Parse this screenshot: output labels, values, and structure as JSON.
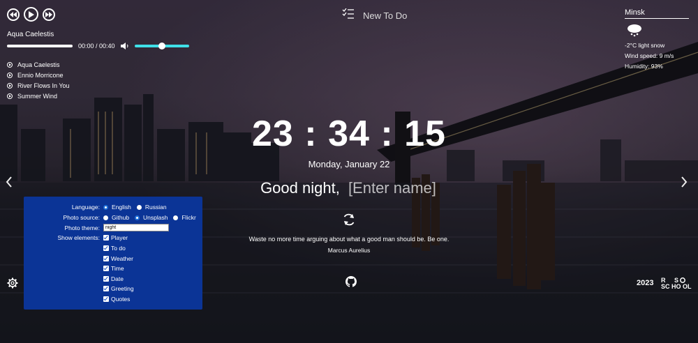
{
  "player": {
    "track_title": "Aqua Caelestis",
    "time": "00:00 / 00:40",
    "progress": 0,
    "volume": 0.5,
    "playlist": [
      "Aqua Caelestis",
      "Ennio Morricone",
      "River Flows In You",
      "Summer Wind"
    ]
  },
  "todo": {
    "label": "New To Do"
  },
  "weather": {
    "city": "Minsk",
    "temp_desc": "-2°C   light snow",
    "wind": "Wind speed: 9 m/s",
    "humidity": "Humidity: 93%"
  },
  "clock": {
    "time": "23 : 34 : 15",
    "date": "Monday, January 22"
  },
  "greeting": {
    "text": "Good night,",
    "name_placeholder": "[Enter name]"
  },
  "quote": {
    "text": "Waste no more time arguing about what a good man should be. Be one.",
    "author": "Marcus Aurelius"
  },
  "settings": {
    "language_label": "Language:",
    "language_options": [
      "English",
      "Russian"
    ],
    "language_selected": "English",
    "source_label": "Photo source:",
    "source_options": [
      "Github",
      "Unsplash",
      "Flickr"
    ],
    "source_selected": "Unsplash",
    "theme_label": "Photo theme:",
    "theme_value": "night",
    "show_label": "Show elements:",
    "elements": [
      "Player",
      "To do",
      "Weather",
      "Time",
      "Date",
      "Greeting",
      "Quotes"
    ]
  },
  "footer": {
    "year": "2023",
    "logo_text": "RS SCHOOL"
  },
  "colors": {
    "settings_bg": "#0b3496",
    "volume_accent": "#3fe0e8"
  }
}
